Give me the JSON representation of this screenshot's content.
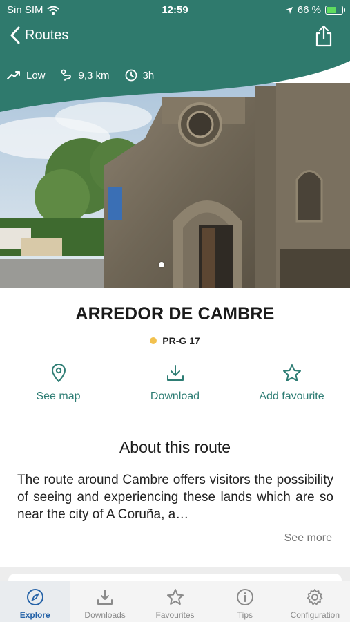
{
  "status_bar": {
    "carrier": "Sin SIM",
    "time": "12:59",
    "battery": "66 %",
    "battery_level": 0.66
  },
  "header": {
    "back_label": "Routes",
    "stats": [
      {
        "icon": "trend-up-icon",
        "value": "Low"
      },
      {
        "icon": "route-icon",
        "value": "9,3 km"
      },
      {
        "icon": "clock-icon",
        "value": "3h"
      }
    ]
  },
  "route": {
    "name": "ARREDOR DE CAMBRE",
    "code": "PR-G 17",
    "code_color": "#f2c14e"
  },
  "actions": [
    {
      "label": "See map",
      "icon": "map-pin-icon"
    },
    {
      "label": "Download",
      "icon": "download-icon"
    },
    {
      "label": "Add favourite",
      "icon": "star-icon"
    }
  ],
  "about": {
    "title": "About this route",
    "text": "The route around Cambre offers visitors the possibility of seeing and experiencing these lands which are so near the city of A Coruña, a…",
    "see_more": "See more"
  },
  "tabbar": [
    {
      "label": "Explore",
      "icon": "compass-icon",
      "active": true
    },
    {
      "label": "Downloads",
      "icon": "download-icon",
      "active": false
    },
    {
      "label": "Favourites",
      "icon": "star-icon",
      "active": false
    },
    {
      "label": "Tips",
      "icon": "info-icon",
      "active": false
    },
    {
      "label": "Configuration",
      "icon": "gear-icon",
      "active": false
    }
  ],
  "colors": {
    "header_green": "#2f7a6d",
    "accent_teal": "#2e7d74",
    "tab_active": "#2663a8"
  }
}
